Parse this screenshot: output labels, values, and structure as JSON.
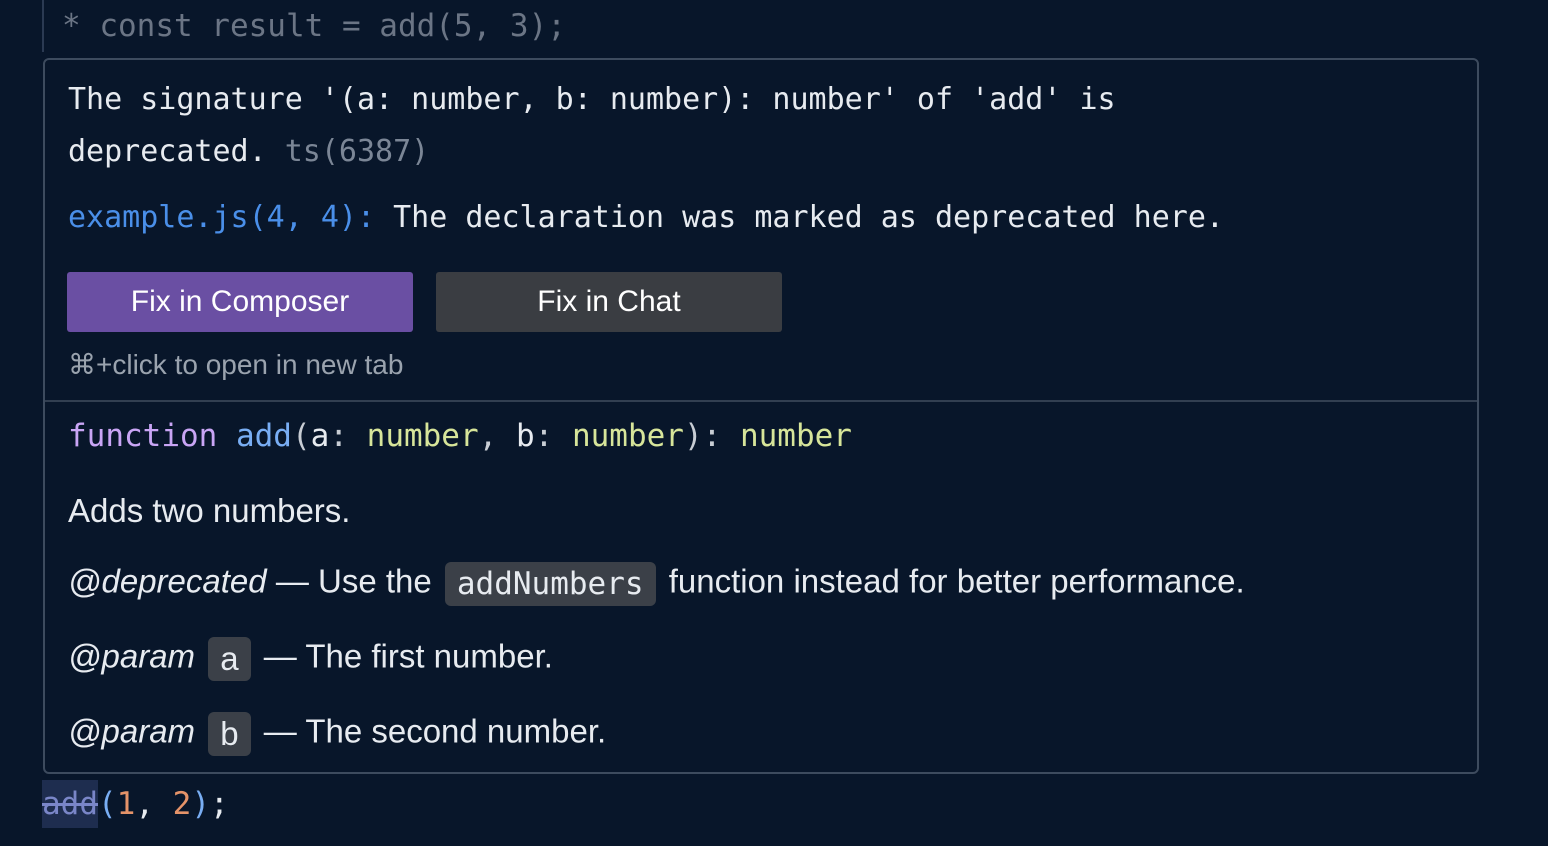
{
  "editor": {
    "top_line": "* const result = add(5, 3);",
    "bottom": {
      "fn_name": "add",
      "open": "(",
      "arg1": "1",
      "sep": ", ",
      "arg2": "2",
      "close": ")",
      "end": ";"
    }
  },
  "diagnostic": {
    "message": "The signature '(a: number, b: number): number' of 'add' is deprecated.",
    "code": "ts(6387)",
    "related_location": "example.js(4, 4):",
    "related_message": "The declaration was marked as deprecated here.",
    "fix_composer_label": "Fix in Composer",
    "fix_chat_label": "Fix in Chat",
    "hint": "⌘+click to open in new tab"
  },
  "docs": {
    "signature": {
      "keyword": "function",
      "name": "add",
      "param_a": "a",
      "type_a": "number",
      "param_b": "b",
      "type_b": "number",
      "return_type": "number"
    },
    "summary": "Adds two numbers.",
    "deprecated_tag": "@deprecated",
    "deprecated_prefix": "— Use the",
    "deprecated_code": "addNumbers",
    "deprecated_suffix": "function instead for better performance.",
    "params": [
      {
        "tag": "@param",
        "name": "a",
        "desc": "— The first number."
      },
      {
        "tag": "@param",
        "name": "b",
        "desc": "— The second number."
      }
    ]
  },
  "colors": {
    "background": "#08162a",
    "composer_button": "#6a4fa3",
    "chat_button": "#3a3d42",
    "link": "#4a8fe9",
    "keyword": "#c9a5f5",
    "function": "#79aef4",
    "type": "#d7e59a"
  }
}
